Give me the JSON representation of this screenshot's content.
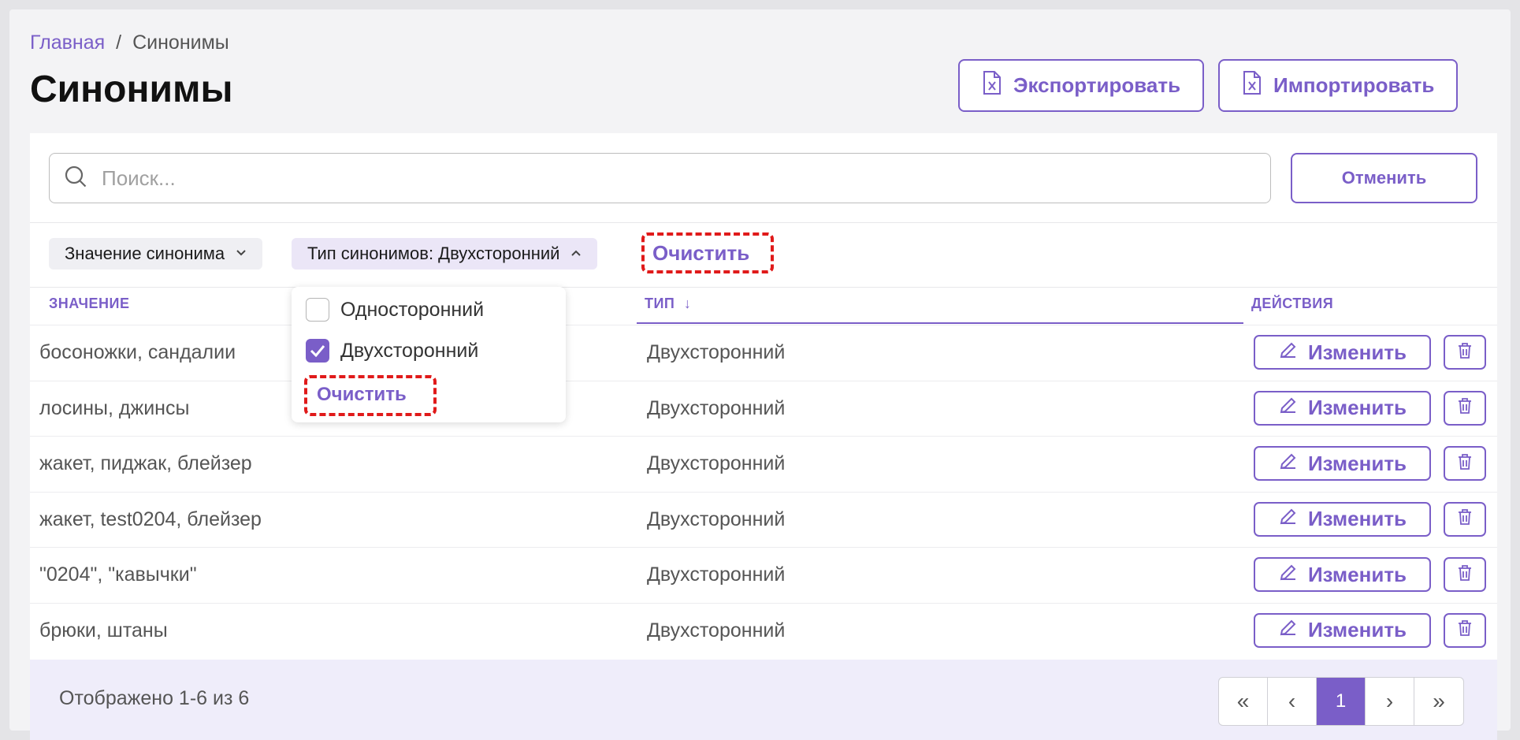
{
  "breadcrumb": {
    "home": "Главная",
    "separator": "/",
    "current": "Синонимы"
  },
  "page": {
    "title": "Синонимы"
  },
  "header_actions": {
    "export_label": "Экспортировать",
    "import_label": "Импортировать"
  },
  "search": {
    "placeholder": "Поиск...",
    "value": "",
    "cancel_label": "Отменить"
  },
  "filters": {
    "synonym_value_label": "Значение синонима",
    "synonym_type_label": "Тип синонимов: Двухсторонний",
    "clear_label": "Очистить"
  },
  "dropdown": {
    "options": [
      {
        "label": "Односторонний",
        "checked": false
      },
      {
        "label": "Двухсторонний",
        "checked": true
      }
    ],
    "clear_label": "Очистить"
  },
  "table": {
    "headers": {
      "value": "ЗНАЧЕНИЕ",
      "type": "ТИП",
      "sort_indicator": "↓",
      "actions": "ДЕЙСТВИЯ"
    },
    "edit_label": "Изменить",
    "rows": [
      {
        "value": "босоножки, сандалии",
        "type": "Двухсторонний"
      },
      {
        "value": "лосины, джинсы",
        "type": "Двухсторонний"
      },
      {
        "value": "жакет, пиджак, блейзер",
        "type": "Двухсторонний"
      },
      {
        "value": "жакет, test0204, блейзер",
        "type": "Двухсторонний"
      },
      {
        "value": "\"0204\", \"кавычки\"",
        "type": "Двухсторонний"
      },
      {
        "value": "брюки, штаны",
        "type": "Двухсторонний"
      }
    ]
  },
  "pagination": {
    "summary": "Отображено 1-6 из 6",
    "first": "«",
    "prev": "‹",
    "current_page": "1",
    "next": "›",
    "last": "»"
  },
  "colors": {
    "accent": "#7a5ec8",
    "highlight": "#e01a1a"
  }
}
